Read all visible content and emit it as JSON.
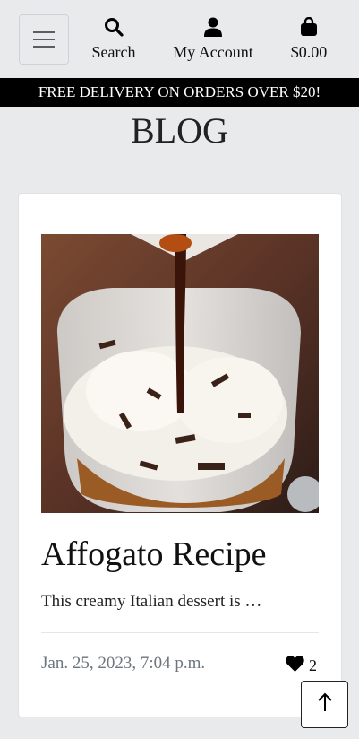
{
  "header": {
    "menu_icon": "hamburger-icon",
    "search": {
      "label": "Search",
      "icon": "search-icon"
    },
    "account": {
      "label": "My Account",
      "icon": "user-icon"
    },
    "bag": {
      "label": "$0.00",
      "icon": "shopping-bag-icon"
    }
  },
  "banner": {
    "text": "FREE DELIVERY ON ORDERS OVER $20!"
  },
  "page": {
    "title": "BLOG"
  },
  "post": {
    "title": "Affogato Recipe",
    "excerpt": "This creamy Italian dessert is …",
    "date": "Jan. 25, 2023, 7:04 p.m.",
    "likes": "2",
    "like_icon": "heart-icon"
  },
  "back_to_top_icon": "arrow-up-icon",
  "colors": {
    "background": "#e9eaec",
    "banner": "#000000",
    "card": "#ffffff",
    "muted_text": "#6c757d"
  }
}
